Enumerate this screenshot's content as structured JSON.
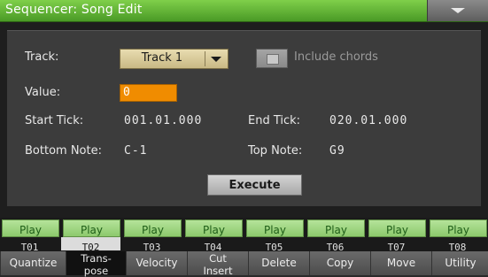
{
  "window": {
    "title": "Sequencer: Song Edit"
  },
  "form": {
    "track_label": "Track:",
    "track_value": "Track 1",
    "include_chords_label": "Include chords",
    "value_label": "Value:",
    "value_value": "0",
    "start_tick_label": "Start Tick:",
    "start_tick_value": "001.01.000",
    "end_tick_label": "End Tick:",
    "end_tick_value": "020.01.000",
    "bottom_note_label": "Bottom Note:",
    "bottom_note_value": "C-1",
    "top_note_label": "Top Note:",
    "top_note_value": "G9",
    "execute_label": "Execute"
  },
  "tracks": {
    "play_label": "Play",
    "names": [
      "T01",
      "T02",
      "T03",
      "T04",
      "T05",
      "T06",
      "T07",
      "T08"
    ],
    "selected": "T02"
  },
  "tabs": [
    {
      "label": "Quantize"
    },
    {
      "label1": "Trans-",
      "label2": "pose",
      "selected": true
    },
    {
      "label": "Velocity"
    },
    {
      "label1": "Cut",
      "label2": "Insert"
    },
    {
      "label": "Delete"
    },
    {
      "label": "Copy"
    },
    {
      "label": "Move"
    },
    {
      "label": "Utility"
    }
  ],
  "colors": {
    "title_bar": "#5cb332",
    "value_field": "#f08c00",
    "play_button": "#9fd37f",
    "dropdown": "#d9cb9b"
  },
  "icons": {
    "menu": "triangle-down-icon",
    "dropdown": "chevron-down-icon"
  }
}
